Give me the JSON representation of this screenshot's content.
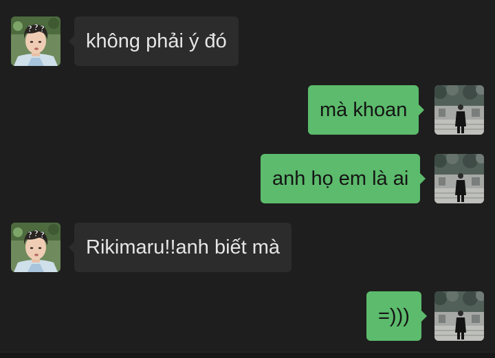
{
  "chat": {
    "messages": [
      {
        "sender": "other",
        "text": "không phải ý đó",
        "avatar": "confused-boy-avatar"
      },
      {
        "sender": "me",
        "text": "mà khoan",
        "avatar": "street-photo-avatar"
      },
      {
        "sender": "me",
        "text": "anh họ em là ai",
        "avatar": "street-photo-avatar"
      },
      {
        "sender": "other",
        "text": "Rikimaru!!anh biết mà",
        "avatar": "confused-boy-avatar"
      },
      {
        "sender": "me",
        "text": "=)))",
        "avatar": "street-photo-avatar"
      }
    ]
  },
  "colors": {
    "background": "#1e1e1e",
    "incoming_bubble": "#2c2c2c",
    "outgoing_bubble": "#5cbb6c",
    "incoming_text": "#e6e6e6",
    "outgoing_text": "#141414"
  },
  "avatars": {
    "other_overlay": "???"
  }
}
